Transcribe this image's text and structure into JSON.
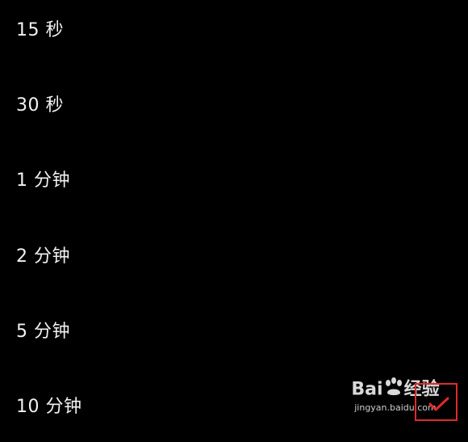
{
  "timeout_options": [
    {
      "label": "15 秒"
    },
    {
      "label": "30 秒"
    },
    {
      "label": "1 分钟"
    },
    {
      "label": "2 分钟"
    },
    {
      "label": "5 分钟"
    },
    {
      "label": "10 分钟"
    }
  ],
  "watermark": {
    "logo_left": "Bai",
    "logo_right": "经验",
    "url": "jingyan.baidu.com"
  },
  "colors": {
    "background": "#000000",
    "text": "#f2f2f2",
    "highlight": "#e12a2a"
  },
  "icons": {
    "selected": "checkmark-icon",
    "watermark_logo": "baidu-paw-icon"
  }
}
